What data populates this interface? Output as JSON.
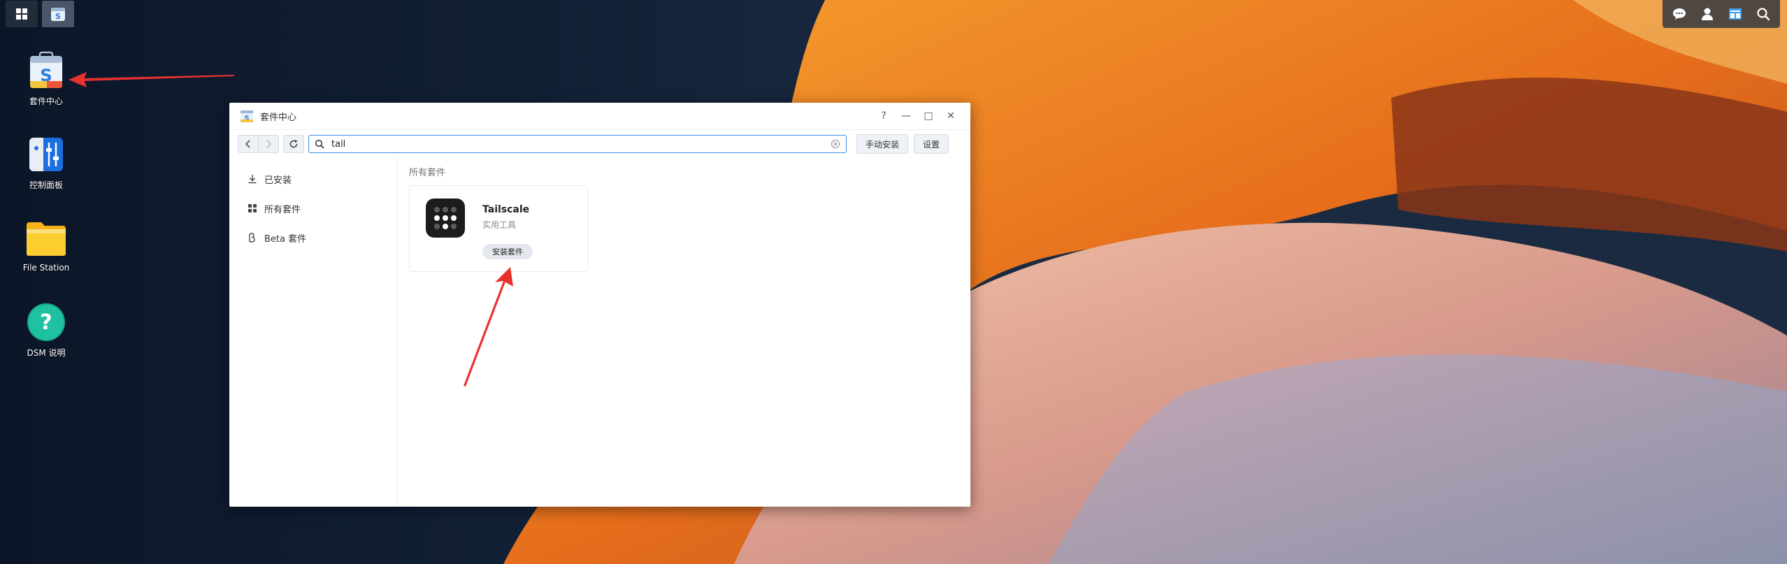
{
  "desktop": {
    "icons": [
      {
        "label": "套件中心",
        "icon": "package-center-icon"
      },
      {
        "label": "控制面板",
        "icon": "control-panel-icon"
      },
      {
        "label": "File Station",
        "icon": "folder-icon"
      },
      {
        "label": "DSM 说明",
        "icon": "help-icon"
      }
    ]
  },
  "taskbar": {
    "left": [
      {
        "icon": "main-menu-icon"
      },
      {
        "icon": "package-center-icon"
      }
    ],
    "right": [
      {
        "icon": "chat-icon"
      },
      {
        "icon": "user-icon"
      },
      {
        "icon": "widgets-icon"
      },
      {
        "icon": "search-icon"
      }
    ]
  },
  "window": {
    "title": "套件中心",
    "controls": [
      "?",
      "—",
      "□",
      "✕"
    ],
    "toolbar": {
      "search_value": "tail",
      "manual_install": "手动安装",
      "settings": "设置"
    },
    "sidebar": [
      {
        "label": "已安装",
        "icon": "download-icon"
      },
      {
        "label": "所有套件",
        "icon": "grid-icon"
      },
      {
        "label": "Beta 套件",
        "icon": "beta-icon"
      }
    ],
    "main": {
      "section_title": "所有套件",
      "package": {
        "name": "Tailscale",
        "category": "实用工具",
        "install_label": "安装套件"
      }
    }
  },
  "colors": {
    "accent": "#3a8ee6",
    "annotation": "#e8312f"
  }
}
